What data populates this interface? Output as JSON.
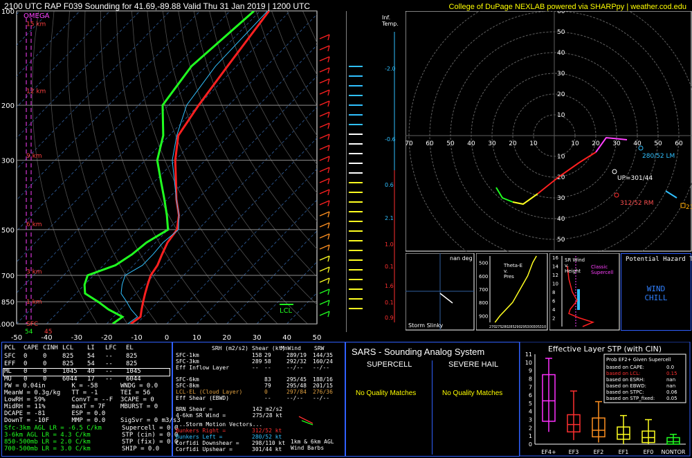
{
  "header": {
    "title": "2100 UTC RAP F039 Sounding for 41.69,-89.88 Valid  Thu 31 Jan 2019 | 1200 UTC",
    "credit": "College of DuPage NEXLAB powered via SHARPpy | weather.cod.edu"
  },
  "colors": {
    "temp": "#ff2020",
    "dewp": "#20ff20",
    "accent": "#ffff00",
    "border": "#3060ff",
    "omega": "#ff40ff"
  },
  "chart_data": [
    {
      "type": "line",
      "name": "skew-t",
      "title": "",
      "xlabel": "",
      "ylabel": "",
      "ylim": [
        1000,
        100
      ],
      "xlim": [
        -50,
        50
      ],
      "pressure_ticks": [
        100,
        200,
        300,
        500,
        700,
        850,
        1000
      ],
      "temp_ticks": [
        -50,
        -40,
        -30,
        -20,
        -10,
        0,
        10,
        20,
        30,
        40,
        50
      ],
      "height_labels": [
        {
          "p": 1000,
          "label": "SFC"
        },
        {
          "p": 850,
          "label": "1 km"
        },
        {
          "p": 680,
          "label": "3 km"
        },
        {
          "p": 480,
          "label": "6 km"
        },
        {
          "p": 290,
          "label": "9 km"
        },
        {
          "p": 180,
          "label": "12 km"
        },
        {
          "p": 110,
          "label": "15 km"
        }
      ],
      "omega_label": "OMEGA",
      "lcl_label": "LCL",
      "sfc_temp_label": "45",
      "sfc_dewp_label": "54",
      "series": [
        {
          "name": "Temperature",
          "p": [
            1000,
            950,
            900,
            850,
            800,
            750,
            700,
            650,
            600,
            550,
            500,
            450,
            400,
            350,
            300,
            250,
            200,
            150,
            100
          ],
          "t": [
            -12,
            -11,
            -13,
            -15,
            -17,
            -19,
            -21,
            -22,
            -24,
            -26,
            -27,
            -31,
            -37,
            -43,
            -50,
            -57,
            -60,
            -63,
            -67
          ]
        },
        {
          "name": "Dewpoint",
          "p": [
            1000,
            950,
            900,
            850,
            800,
            750,
            700,
            650,
            600,
            550,
            500,
            450,
            400,
            350,
            300,
            250,
            200,
            150,
            100
          ],
          "t": [
            -18,
            -17,
            -24,
            -30,
            -37,
            -40,
            -42,
            -36,
            -34,
            -33,
            -30,
            -35,
            -41,
            -48,
            -56,
            -62,
            -72,
            -75,
            -72
          ]
        }
      ]
    },
    {
      "type": "line",
      "name": "hodograph",
      "title": "",
      "ring_labels": [
        "10",
        "20",
        "30",
        "40",
        "50",
        "60",
        "70"
      ],
      "x_ticks": [
        "70",
        "60",
        "50",
        "40",
        "30",
        "20",
        "10",
        "10",
        "20",
        "30",
        "40",
        "50",
        "60",
        "70"
      ],
      "y_ticks": [
        "60",
        "50",
        "40",
        "30",
        "20",
        "10",
        "10",
        "20",
        "30",
        "40",
        "50",
        "60"
      ],
      "annotations": {
        "lm": "280/52 LM",
        "up": "UP=301/44",
        "rm": "312/52 RM",
        "mean": "23"
      },
      "series": [
        {
          "name": "0-1km",
          "u": [
            28,
            25,
            20
          ],
          "v": [
            -25,
            -30,
            -32
          ]
        },
        {
          "name": "1-3km",
          "u": [
            20,
            15,
            8
          ],
          "v": [
            -32,
            -33,
            -28
          ]
        },
        {
          "name": "3-6km",
          "u": [
            8,
            -2,
            -12,
            -20
          ],
          "v": [
            -28,
            -20,
            -13,
            -8
          ]
        },
        {
          "name": "6-9km",
          "u": [
            -20,
            -25,
            -35
          ],
          "v": [
            -8,
            -1,
            -2
          ]
        }
      ]
    },
    {
      "type": "line",
      "name": "theta-e",
      "title": "Theta-E\nv.\nPres",
      "y_ticks": [
        "500",
        "600",
        "700",
        "800",
        "900"
      ],
      "x_ticks": [
        "270",
        "275",
        "280",
        "285",
        "290",
        "295",
        "300",
        "305",
        "310"
      ],
      "series": [
        {
          "name": "Theta-E",
          "theta": [
            272,
            276,
            281,
            286,
            292,
            298,
            302,
            305
          ],
          "p": [
            950,
            900,
            850,
            800,
            700,
            600,
            500,
            450
          ]
        }
      ]
    },
    {
      "type": "line",
      "name": "sr-wind",
      "title": "SR Wind\nv.\nHeight",
      "subtitle": "Classic\nSupercell",
      "y_ticks": [
        "16",
        "14",
        "12",
        "10",
        "8",
        "6",
        "4",
        "2"
      ],
      "x_ticks": [
        "0",
        "20",
        "40",
        "60",
        "80"
      ],
      "series": [
        {
          "name": "SR Wind",
          "w": [
            30,
            45,
            25,
            10,
            12,
            22,
            15,
            10,
            8
          ],
          "h": [
            0,
            1,
            2,
            3,
            4,
            6,
            8,
            11,
            14
          ]
        }
      ]
    },
    {
      "type": "bar",
      "name": "effective-layer-stp",
      "title": "Effective Layer STP (with CIN)",
      "categories": [
        "EF4+",
        "EF3",
        "EF2",
        "EF1",
        "EF0",
        "NONTOR"
      ],
      "y_ticks": [
        "0",
        "1",
        "2",
        "3",
        "4",
        "5",
        "6",
        "7",
        "8",
        "9",
        "10",
        "11"
      ],
      "ylim": [
        0,
        11
      ],
      "boxes": [
        {
          "cat": "EF4+",
          "low": 1.5,
          "q1": 2.8,
          "med": 5.3,
          "q3": 8.5,
          "high": 10.5,
          "color": "#ff30ff"
        },
        {
          "cat": "EF3",
          "low": 0.5,
          "q1": 1.5,
          "med": 2.4,
          "q3": 3.6,
          "high": 6.5,
          "color": "#ff3030"
        },
        {
          "cat": "EF2",
          "low": 0.2,
          "q1": 0.9,
          "med": 1.7,
          "q3": 3.2,
          "high": 5.2,
          "color": "#ff9020"
        },
        {
          "cat": "EF1",
          "low": 0.0,
          "q1": 0.6,
          "med": 1.2,
          "q3": 2.1,
          "high": 3.5,
          "color": "#ffff20"
        },
        {
          "cat": "EF0",
          "low": 0.0,
          "q1": 0.2,
          "med": 0.8,
          "q3": 1.6,
          "high": 3.0,
          "color": "#ffff20"
        },
        {
          "cat": "NONTOR",
          "low": 0.0,
          "q1": 0.0,
          "med": 0.3,
          "q3": 0.8,
          "high": 1.2,
          "color": "#20ff20"
        }
      ]
    }
  ],
  "inferred_temp": {
    "label": "Inf.\nTemp.",
    "values": [
      "-2.0",
      "-0.6",
      "0.6",
      "2.1",
      "1.0",
      "0.1",
      "1.6",
      "0.1",
      "0.9"
    ]
  },
  "storm_slinky": {
    "label": "Storm Slinky",
    "value": "nan deg"
  },
  "hazard": {
    "title": "Potential Hazard Type",
    "value": "WIND\nCHILL"
  },
  "parcel_table": {
    "headers": [
      "PCL",
      "CAPE",
      "CINH",
      "LCL",
      "LI",
      "LFC",
      "EL"
    ],
    "rows": [
      [
        "SFC",
        "0",
        "0",
        "825",
        "54",
        "--",
        "825"
      ],
      [
        "EFF",
        "0",
        "0",
        "825",
        "54",
        "--",
        "825"
      ],
      [
        "ML",
        "0",
        "0",
        "1045",
        "40",
        "--",
        "1045"
      ],
      [
        "MU",
        "0",
        "0",
        "6044",
        "17",
        "--",
        "6044"
      ]
    ]
  },
  "thermo_indices": [
    "PW = 0.04in       K = -58      WNDG = 0.0",
    "MeanW = 0.3g/kg   TT = -1      TEI = 56",
    "LowRH = 59%       ConvT = --F  3CAPE = 0",
    "MidRH = 11%       maxT = 7F    MBURST = 0",
    "DCAPE = -81       ESP = 0.0",
    "DownT = -10F      MMP = 0.0    SigSvr = 0 m3/s3"
  ],
  "lapse_rates": [
    "Sfc-3km AGL LR = -6.5 C/km",
    "3-6km AGL LR = 4.3 C/km",
    "850-500mb LR = 2.0 C/km",
    "700-500mb LR = 3.0 C/km"
  ],
  "composites": [
    "Supercell = 0.0",
    "STP (cin) = 0.0",
    "STP (fix) = 0.0",
    "SHIP = 0.0"
  ],
  "kinematics": {
    "headers": [
      "SRH (m2/s2)",
      "Shear (kt)",
      "MnWind",
      "SRW"
    ],
    "rows": [
      [
        "SFC-1km",
        "158",
        "29",
        "289/19",
        "144/35"
      ],
      [
        "SFC-3km",
        "289",
        "58",
        "292/32",
        "160/24"
      ],
      [
        "Eff Inflow Layer",
        "--",
        "--",
        "--/--",
        "--/--"
      ],
      [
        "SFC-6km",
        "",
        "83",
        "295/45",
        "188/16"
      ],
      [
        "SFC-8km",
        "",
        "79",
        "295/48",
        "201/15"
      ],
      [
        "LCL-EL (Cloud Layer)",
        "",
        "0",
        "297/84",
        "276/36"
      ],
      [
        "Eff Shear (EBWD)",
        "",
        "--",
        "--/--",
        "--/--"
      ]
    ],
    "extra": [
      "BRN Shear =            142 m2/s2",
      "4-6km SR Wind =        275/28 kt"
    ],
    "motion_title": "...Storm Motion Vectors...",
    "motions": [
      [
        "Bunkers Right =",
        "312/52 kt"
      ],
      [
        "Bunkers Left =",
        "280/52 kt"
      ],
      [
        "Corfidi Downshear =",
        "298/110 kt"
      ],
      [
        "Corfidi Upshear =",
        "301/44 kt"
      ]
    ],
    "barb_caption": "1km & 6km AGL\nWind Barbs"
  },
  "sars": {
    "title": "SARS - Sounding Analog System",
    "supercell": "SUPERCELL",
    "hail": "SEVERE HAIL",
    "supercell_result": "No Quality Matches",
    "hail_result": "No Quality Matches"
  },
  "stp_probs": {
    "title": "Prob EF2+ Given Supercell",
    "rows": [
      [
        "based on CAPE:",
        "0.0"
      ],
      [
        "based on LCL:",
        "0.15"
      ],
      [
        "based on ESRH:",
        "nan"
      ],
      [
        "based on EBWD:",
        "nan"
      ],
      [
        "based on STPC:",
        "0.06"
      ],
      [
        "based on STP_fixed:",
        "0.05"
      ]
    ]
  }
}
